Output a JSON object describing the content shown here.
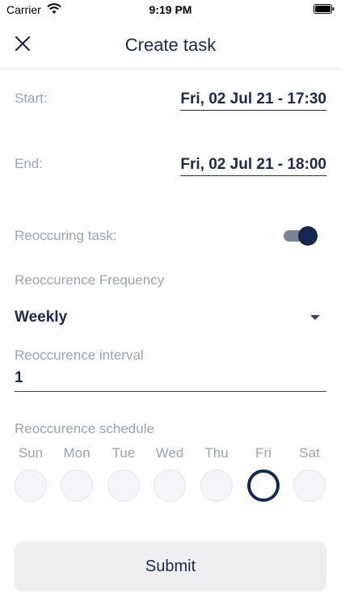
{
  "status_bar": {
    "carrier": "Carrier",
    "time": "9:19 PM"
  },
  "header": {
    "title": "Create task",
    "close_icon": "close-icon"
  },
  "form": {
    "start_label": "Start:",
    "start_value": "Fri, 02 Jul 21 - 17:30",
    "end_label": "End:",
    "end_value": "Fri, 02 Jul 21 - 18:00",
    "reoccurring_label": "Reoccuring task:",
    "reoccurring_on": true,
    "frequency_label": "Reoccurence Frequency",
    "frequency_value": "Weekly",
    "interval_label": "Reoccurence interval",
    "interval_value": "1",
    "schedule_label": "Reoccurence schedule",
    "days": [
      {
        "label": "Sun",
        "selected": false
      },
      {
        "label": "Mon",
        "selected": false
      },
      {
        "label": "Tue",
        "selected": false
      },
      {
        "label": "Wed",
        "selected": false
      },
      {
        "label": "Thu",
        "selected": false
      },
      {
        "label": "Fri",
        "selected": true
      },
      {
        "label": "Sat",
        "selected": false
      }
    ]
  },
  "submit_label": "Submit",
  "colors": {
    "primary": "#15284d",
    "muted_text": "#9aa2b1",
    "button_bg": "#eeeef0"
  }
}
